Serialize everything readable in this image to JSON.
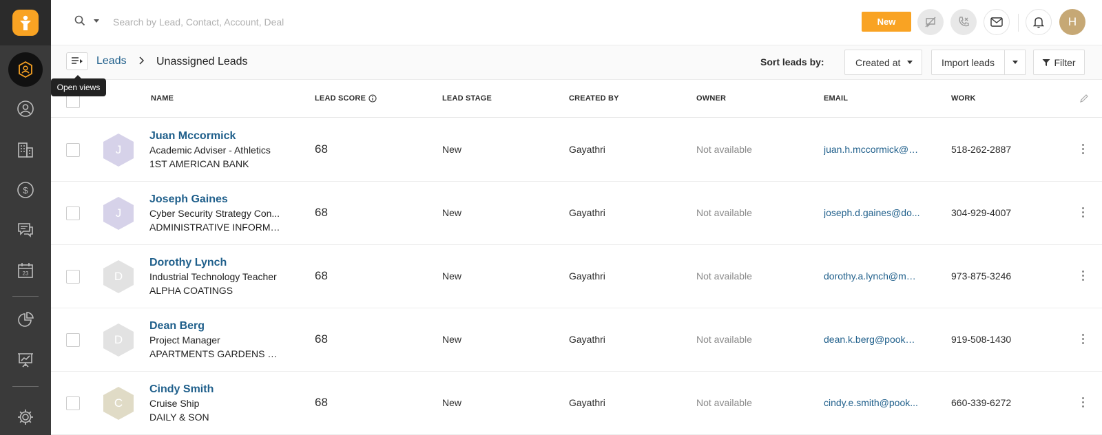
{
  "sidebar": {
    "items": [
      {
        "name": "leads",
        "icon": "hexagon-person-icon",
        "active": true
      },
      {
        "name": "contacts",
        "icon": "person-circle-icon"
      },
      {
        "name": "accounts",
        "icon": "building-icon"
      },
      {
        "name": "deals",
        "icon": "dollar-circle-icon"
      },
      {
        "name": "conversations",
        "icon": "chat-icon"
      },
      {
        "name": "calendar",
        "icon": "calendar-icon"
      },
      {
        "name": "reports",
        "icon": "pie-chart-icon"
      },
      {
        "name": "analytics",
        "icon": "presentation-icon"
      },
      {
        "name": "settings",
        "icon": "gear-icon"
      }
    ]
  },
  "topbar": {
    "search_placeholder": "Search by Lead, Contact, Account, Deal",
    "new_label": "New",
    "avatar_initial": "H"
  },
  "subheader": {
    "breadcrumb_root": "Leads",
    "page_title": "Unassigned Leads",
    "sort_label": "Sort leads by:",
    "sort_value": "Created at",
    "import_label": "Import leads",
    "filter_label": "Filter",
    "tooltip": "Open views"
  },
  "table": {
    "headers": {
      "name": "NAME",
      "lead_score": "LEAD SCORE",
      "lead_stage": "LEAD STAGE",
      "created_by": "CREATED BY",
      "owner": "OWNER",
      "email": "EMAIL",
      "work": "WORK"
    },
    "rows": [
      {
        "initial": "J",
        "avatar_color": "#d6d2e9",
        "name": "Juan Mccormick",
        "title": "Academic Adviser - Athletics",
        "company": "1ST AMERICAN BANK",
        "score": "68",
        "stage": "New",
        "created_by": "Gayathri",
        "owner": "Not available",
        "email": "juan.h.mccormick@s...",
        "work": "518-262-2887"
      },
      {
        "initial": "J",
        "avatar_color": "#d6d2e9",
        "name": "Joseph Gaines",
        "title": "Cyber Security Strategy Con...",
        "company": "ADMINISTRATIVE INFORMA...",
        "score": "68",
        "stage": "New",
        "created_by": "Gayathri",
        "owner": "Not available",
        "email": "joseph.d.gaines@do...",
        "work": "304-929-4007"
      },
      {
        "initial": "D",
        "avatar_color": "#e2e2e2",
        "name": "Dorothy Lynch",
        "title": "Industrial Technology Teacher",
        "company": "ALPHA COATINGS",
        "score": "68",
        "stage": "New",
        "created_by": "Gayathri",
        "owner": "Not available",
        "email": "dorothy.a.lynch@mai...",
        "work": "973-875-3246"
      },
      {
        "initial": "D",
        "avatar_color": "#e2e2e2",
        "name": "Dean Berg",
        "title": "Project Manager",
        "company": "APARTMENTS GARDENS NS...",
        "score": "68",
        "stage": "New",
        "created_by": "Gayathri",
        "owner": "Not available",
        "email": "dean.k.berg@pookm...",
        "work": "919-508-1430"
      },
      {
        "initial": "C",
        "avatar_color": "#e0dbc6",
        "name": "Cindy Smith",
        "title": "Cruise Ship",
        "company": "DAILY & SON",
        "score": "68",
        "stage": "New",
        "created_by": "Gayathri",
        "owner": "Not available",
        "email": "cindy.e.smith@pook...",
        "work": "660-339-6272"
      }
    ]
  },
  "colors": {
    "accent": "#f9a323",
    "link": "#1f5f8b",
    "sidebar": "#3a3a3a"
  }
}
